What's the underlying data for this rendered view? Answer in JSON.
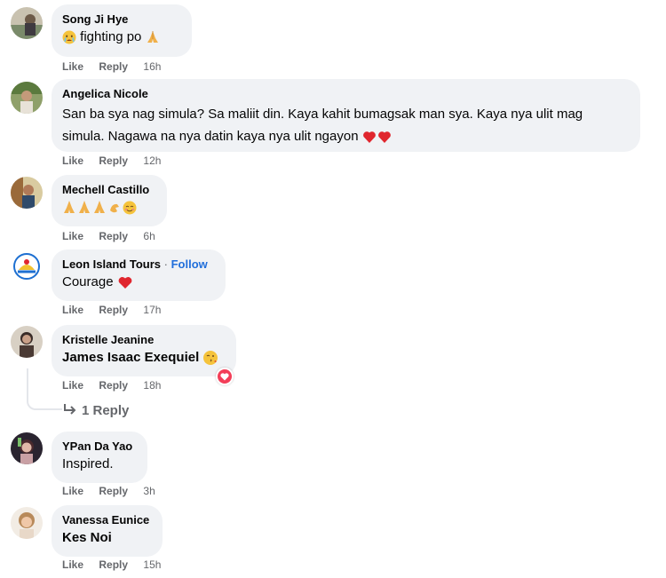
{
  "comments": [
    {
      "author": "Song Ji Hye",
      "text": "fighting po",
      "like": "Like",
      "reply": "Reply",
      "time": "16h",
      "colors": {
        "avatar": "#7a8a6a"
      }
    },
    {
      "author": "Angelica Nicole",
      "text": "San ba sya nag simula? Sa maliit din. Kaya kahit bumagsak man sya. Kaya nya ulit mag simula. Nagawa na nya datin kaya nya ulit ngayon",
      "like": "Like",
      "reply": "Reply",
      "time": "12h",
      "colors": {
        "avatar": "#6b7f4e"
      }
    },
    {
      "author": "Mechell Castillo",
      "text": "",
      "like": "Like",
      "reply": "Reply",
      "time": "6h",
      "colors": {
        "avatar": "#a08a5e"
      }
    },
    {
      "author": "Leon Island Tours",
      "follow_sep": "·",
      "follow": "Follow",
      "text": "Courage",
      "like": "Like",
      "reply": "Reply",
      "time": "17h",
      "colors": {
        "avatar": "#1d6fd1"
      }
    },
    {
      "author": "Kristelle Jeanine",
      "text": "James Isaac Exequiel",
      "like": "Like",
      "reply": "Reply",
      "time": "18h",
      "replies": "1 Reply",
      "colors": {
        "avatar": "#8a7a6e"
      }
    },
    {
      "author": "YPan Da Yao",
      "text": "Inspired.",
      "like": "Like",
      "reply": "Reply",
      "time": "3h",
      "colors": {
        "avatar": "#6d4a3f"
      }
    },
    {
      "author": "Vanessa Eunice",
      "text": "Kes Noi",
      "like": "Like",
      "reply": "Reply",
      "time": "15h",
      "colors": {
        "avatar": "#b88a6a"
      }
    }
  ],
  "icons": {
    "reaction": "heart-icon",
    "reply_arrow": "reply-arrow-icon"
  },
  "colors": {
    "bubble": "#f0f2f5",
    "meta": "#65676b",
    "follow": "#216fdb",
    "heart": "#f33e58"
  }
}
